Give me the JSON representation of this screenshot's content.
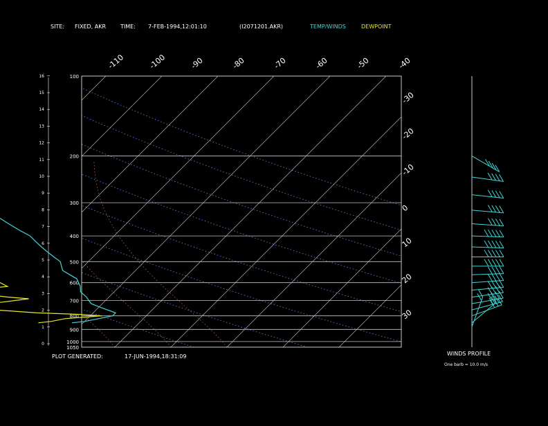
{
  "header": {
    "site_label": "SITE:",
    "site_value": "FIXED, AKR",
    "time_label": "TIME:",
    "time_value": "7-FEB-1994,12:01:10",
    "file_id": "(I2071201.AKR)",
    "legend_temp": "TEMP/WINDS",
    "legend_dew": "DEWPOINT"
  },
  "footer": {
    "generated_label": "PLOT GENERATED:",
    "generated_value": "17-JUN-1994,18:31:09"
  },
  "winds_panel": {
    "title": "WINDS PROFILE",
    "note": "One barb = 10.0 m/s"
  },
  "colors": {
    "temp": "#3fd9d9",
    "dewpoint": "#e8e82a",
    "isotherm": "#b0b0b0",
    "dry_adiabat": "#5a7fd6",
    "moist_adiabat": "#c06838",
    "grid": "#c8c8c8"
  },
  "chart_data": {
    "type": "line",
    "pressure_levels": [
      "100",
      "200",
      "300",
      "400",
      "500",
      "600",
      "700",
      "800",
      "900",
      "1000",
      "1050"
    ],
    "height_ticks": [
      "0",
      "1",
      "2",
      "3",
      "4",
      "5",
      "6",
      "7",
      "8",
      "9",
      "10",
      "11",
      "12",
      "13",
      "14",
      "15",
      "16"
    ],
    "isotherm_labels_top": [
      "-110",
      "-100",
      "-90",
      "-80",
      "-70",
      "-60",
      "-50",
      "-40"
    ],
    "isotherm_labels_right": [
      "-30",
      "-20",
      "-10",
      "0",
      "10",
      "20",
      "30"
    ],
    "series": [
      {
        "pressure": [
          850,
          840,
          820,
          800,
          780,
          760,
          740,
          720,
          700,
          680,
          650,
          620,
          600,
          580,
          560,
          540,
          520,
          500,
          480,
          460,
          440,
          420,
          400,
          380,
          360,
          340,
          320,
          300,
          280,
          260,
          240,
          230,
          220
        ],
        "temp": [
          -2,
          0,
          2,
          4,
          4,
          2,
          0,
          -2,
          -3,
          -4,
          -6,
          -7,
          -8,
          -9,
          -11,
          -13,
          -14,
          -15,
          -17,
          -19,
          -21,
          -23,
          -25,
          -28,
          -31,
          -34,
          -37,
          -40,
          -43,
          -46,
          -50,
          -52,
          -54
        ]
      },
      {
        "pressure": [
          850,
          840,
          820,
          800,
          790,
          780,
          760,
          740,
          720,
          700,
          690,
          680,
          660,
          650,
          640,
          620,
          600,
          580,
          560,
          540,
          520,
          510,
          500,
          490,
          480,
          460,
          440,
          420,
          410,
          400,
          390,
          380,
          360,
          340,
          320,
          300,
          280,
          260,
          240,
          220
        ],
        "temp": [
          -8,
          -6,
          -4,
          2,
          -2,
          -10,
          -18,
          -22,
          -20,
          -16,
          -14,
          -18,
          -24,
          -28,
          -26,
          -20,
          -22,
          -28,
          -34,
          -36,
          -34,
          -38,
          -44,
          -42,
          -36,
          -32,
          -38,
          -40,
          -37,
          -40,
          -38,
          -38,
          -42,
          -48,
          -50,
          -55,
          -56,
          -57,
          -58,
          -60
        ]
      }
    ],
    "winds": [
      {
        "pressure": 880,
        "speed": 15,
        "dir": 200
      },
      {
        "pressure": 850,
        "speed": 22,
        "dir": 230
      },
      {
        "pressure": 800,
        "speed": 28,
        "dir": 250
      },
      {
        "pressure": 760,
        "speed": 32,
        "dir": 255
      },
      {
        "pressure": 720,
        "speed": 35,
        "dir": 260
      },
      {
        "pressure": 680,
        "speed": 38,
        "dir": 262
      },
      {
        "pressure": 640,
        "speed": 40,
        "dir": 265
      },
      {
        "pressure": 600,
        "speed": 42,
        "dir": 266
      },
      {
        "pressure": 560,
        "speed": 44,
        "dir": 268
      },
      {
        "pressure": 520,
        "speed": 45,
        "dir": 270
      },
      {
        "pressure": 480,
        "speed": 46,
        "dir": 270
      },
      {
        "pressure": 440,
        "speed": 46,
        "dir": 272
      },
      {
        "pressure": 400,
        "speed": 45,
        "dir": 272
      },
      {
        "pressure": 360,
        "speed": 44,
        "dir": 274
      },
      {
        "pressure": 320,
        "speed": 43,
        "dir": 275
      },
      {
        "pressure": 280,
        "speed": 42,
        "dir": 276
      },
      {
        "pressure": 240,
        "speed": 40,
        "dir": 278
      },
      {
        "pressure": 200,
        "speed": 38,
        "dir": 300
      }
    ]
  }
}
